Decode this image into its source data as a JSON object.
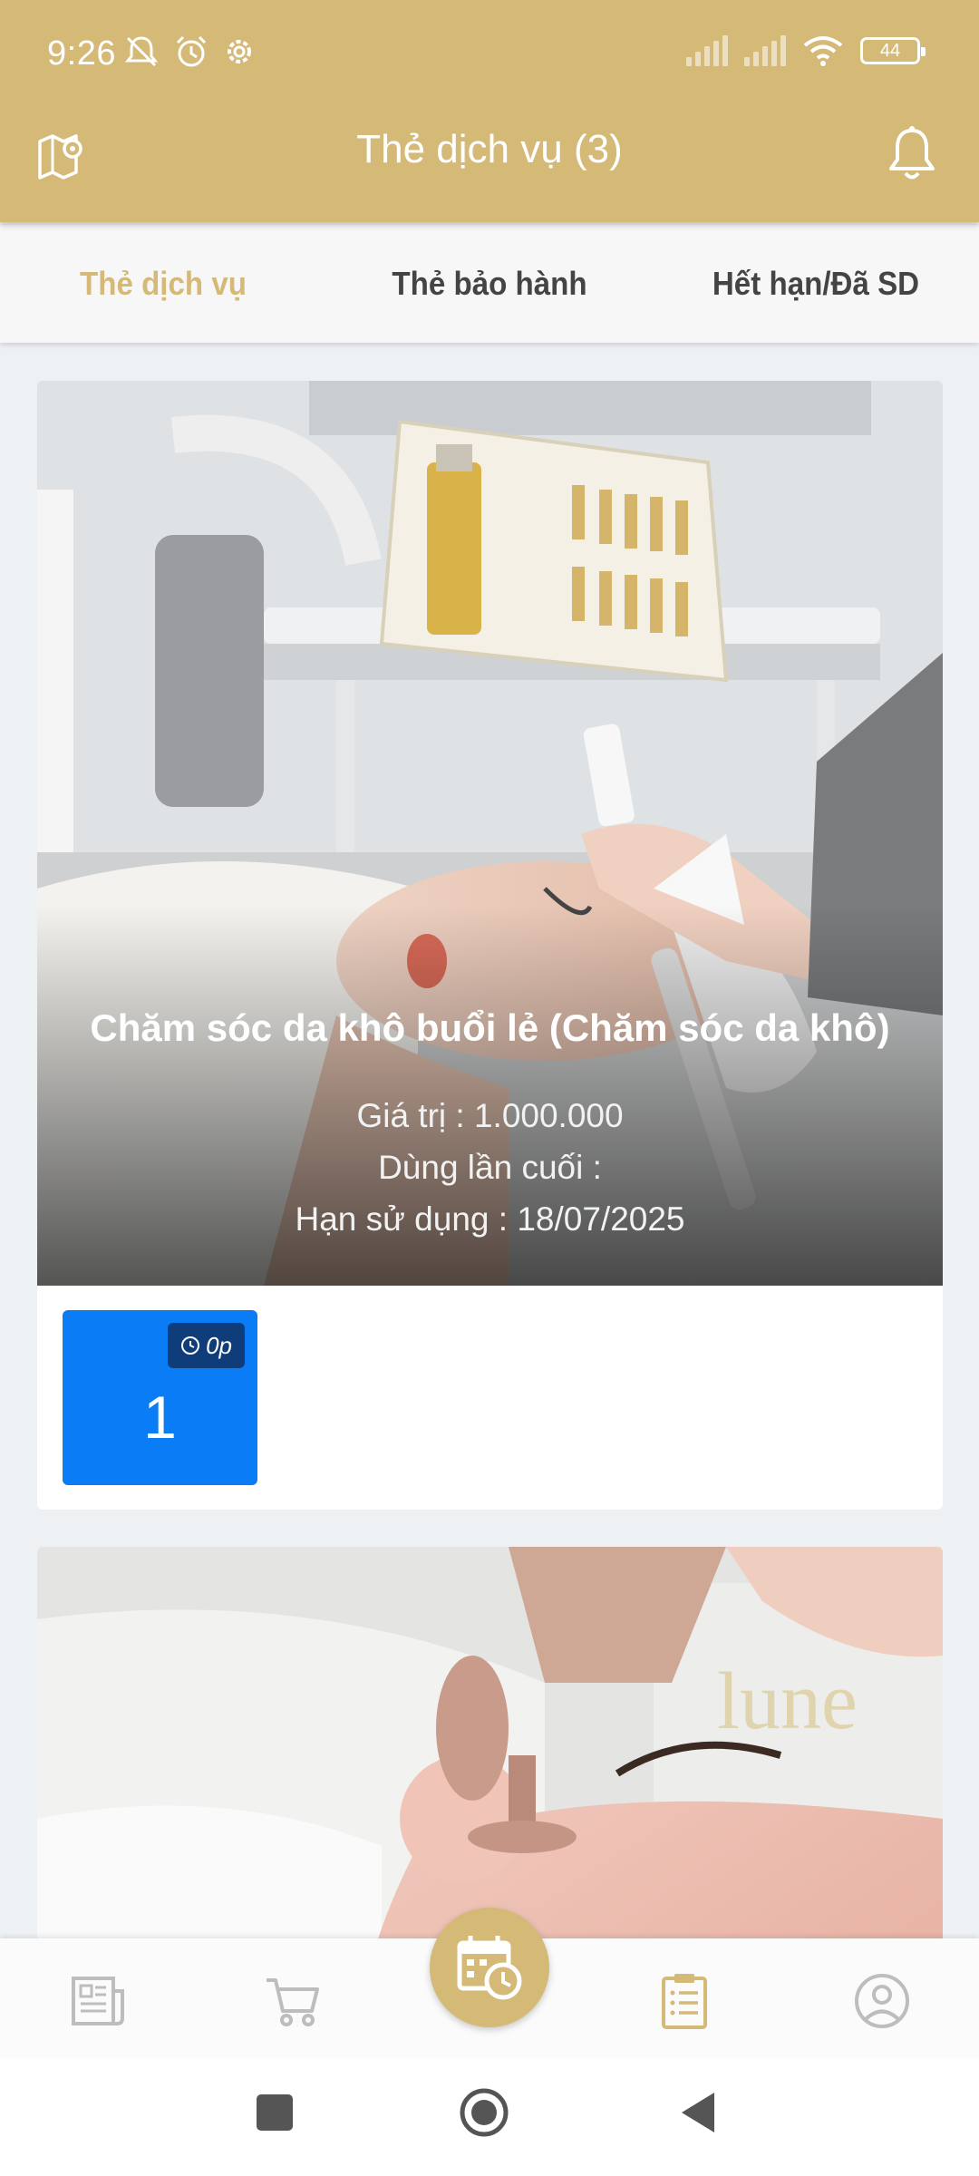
{
  "status": {
    "time": "9:26",
    "battery": "44"
  },
  "topbar": {
    "title": "Thẻ dịch vụ (3)"
  },
  "tabs": [
    {
      "label": "Thẻ dịch vụ",
      "active": true
    },
    {
      "label": "Thẻ bảo hành",
      "active": false
    },
    {
      "label": "Hết hạn/Đã SD",
      "active": false
    }
  ],
  "cards": [
    {
      "title": "Chăm sóc da khô buổi lẻ (Chăm sóc da khô)",
      "value_line": "Giá trị : 1.000.000",
      "last_used_line": "Dùng lần cuối :",
      "expiry_line": "Hạn sử dụng : 18/07/2025",
      "session": {
        "badge": "0p",
        "count": "1"
      }
    }
  ],
  "colors": {
    "brand_gold": "#d4b977",
    "session_blue": "#0a7cf5",
    "badge_navy": "#0f3d7a"
  },
  "icons": {
    "header_left": "map-pin-icon",
    "header_right": "bell-icon",
    "nav": [
      "news-icon",
      "cart-icon",
      "calendar-clock-icon",
      "clipboard-list-icon",
      "user-circle-icon"
    ]
  }
}
